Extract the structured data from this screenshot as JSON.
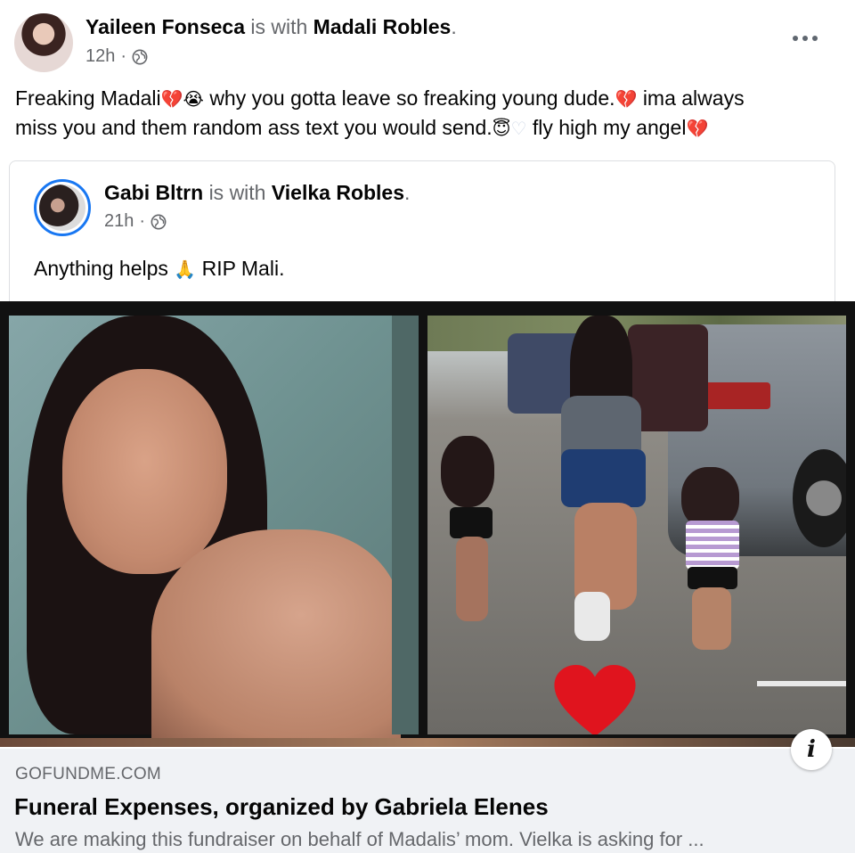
{
  "post": {
    "author": "Yaileen Fonseca",
    "with_text": "is with",
    "tagged": "Madali Robles",
    "period": ".",
    "time": "12h",
    "dot": "·",
    "text_line1": "Freaking Madali",
    "text_line1b": "why you gotta leave so freaking young dude.",
    "text_line1c": "ima always",
    "text_line2": "miss you and them random ass text you would send.",
    "text_line2b": "fly high my angel",
    "more_icon": "more-horizontal-icon"
  },
  "shared": {
    "author": "Gabi Bltrn",
    "with_text": "is with",
    "tagged": "Vielka Robles",
    "period": ".",
    "time": "21h",
    "dot": "·",
    "text": "Anything helps",
    "text_b": "RIP Mali."
  },
  "link": {
    "domain": "GOFUNDME.COM",
    "title": "Funeral Expenses, organized by Gabriela Elenes",
    "description": "We are making this fundraiser on behalf of Madalis’ mom. Vielka is asking for ...",
    "info_label": "i"
  },
  "colors": {
    "muted": "#65676b",
    "preview_bg": "#f0f2f5",
    "heart": "#e0141e",
    "broken_heart": "#e0245e"
  }
}
